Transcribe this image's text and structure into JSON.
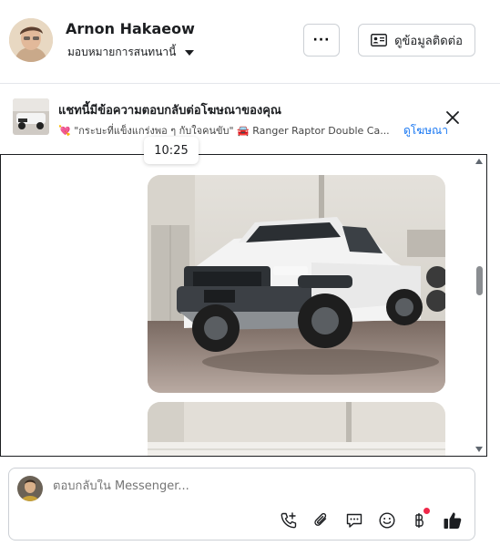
{
  "header": {
    "name": "Arnon Hakaeow",
    "assign_label": "มอบหมายการสนทนานี้",
    "more_label": "···",
    "contact_label": "ดูข้อมูลติดต่อ"
  },
  "ad": {
    "title": "แชทนี้มีข้อความตอบกลับต่อโฆษณาของคุณ",
    "subtitle": "💘 \"กระบะที่แข็งแกร่งพอ ๆ กับใจคนขับ\" 🚘 Ranger Raptor Double Ca...",
    "link_label": "ดูโฆษณา"
  },
  "chat": {
    "timestamp": "10:25"
  },
  "composer": {
    "placeholder": "ตอบกลับใน Messenger..."
  },
  "colors": {
    "accent": "#1877f2",
    "notification": "#f02849"
  }
}
